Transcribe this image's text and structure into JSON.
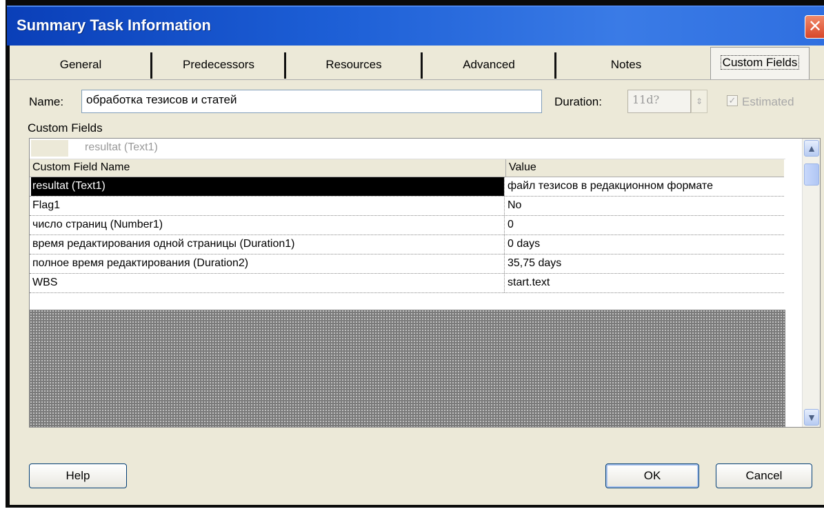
{
  "window": {
    "title": "Summary Task Information",
    "close_label": "✕"
  },
  "tabs": [
    {
      "label": "General"
    },
    {
      "label": "Predecessors"
    },
    {
      "label": "Resources"
    },
    {
      "label": "Advanced"
    },
    {
      "label": "Notes"
    },
    {
      "label": "Custom Fields",
      "active": true
    }
  ],
  "form": {
    "name_label": "Name:",
    "name_value": "обработка тезисов и статей",
    "duration_label": "Duration:",
    "duration_value": "11d?",
    "estimated_label": "Estimated",
    "estimated_checked": true
  },
  "custom_fields": {
    "section_label": "Custom Fields",
    "edit_value": "resultat (Text1)",
    "columns": [
      "Custom Field Name",
      "Value"
    ],
    "rows": [
      {
        "name": "resultat (Text1)",
        "value": "файл тезисов в редакционном формате",
        "selected": true
      },
      {
        "name": "Flag1",
        "value": "No"
      },
      {
        "name": "число страниц (Number1)",
        "value": "0"
      },
      {
        "name": "время редактирования одной страницы (Duration1)",
        "value": "0 days"
      },
      {
        "name": "полное время редактирования (Duration2)",
        "value": "35,75 days"
      },
      {
        "name": "WBS",
        "value": "start.text"
      }
    ]
  },
  "buttons": {
    "help": "Help",
    "ok": "OK",
    "cancel": "Cancel"
  }
}
